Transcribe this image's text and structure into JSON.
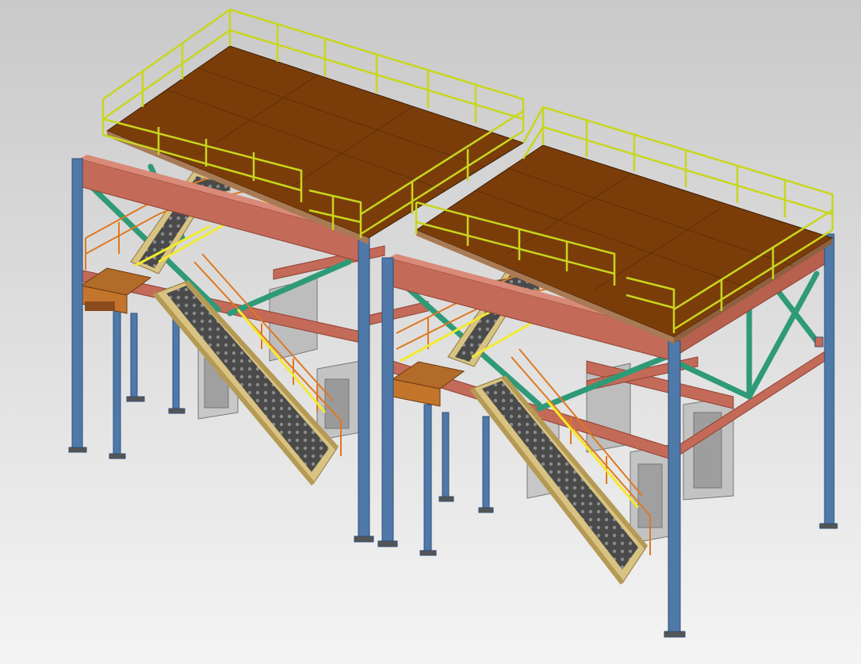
{
  "scene": {
    "subject": "3d-steel-platform-model",
    "colors": {
      "background_top": "#c9c9c9",
      "background_bottom": "#f4f4f4",
      "column": "#4f79a8",
      "column_dark": "#2f4f78",
      "beam": "#c46a58",
      "beam_dark": "#8f4133",
      "deck": "#7a3d0a",
      "deck_edge": "#a87a55",
      "brace": "#2f9a78",
      "handrail": "#c8d61e",
      "stair_stringer": "#d9c382",
      "stair_tread": "#3a3a3a",
      "stair_rail": "#e07820",
      "hopper": "#bdbdbd",
      "hopper_dark": "#8e8e8e"
    }
  }
}
